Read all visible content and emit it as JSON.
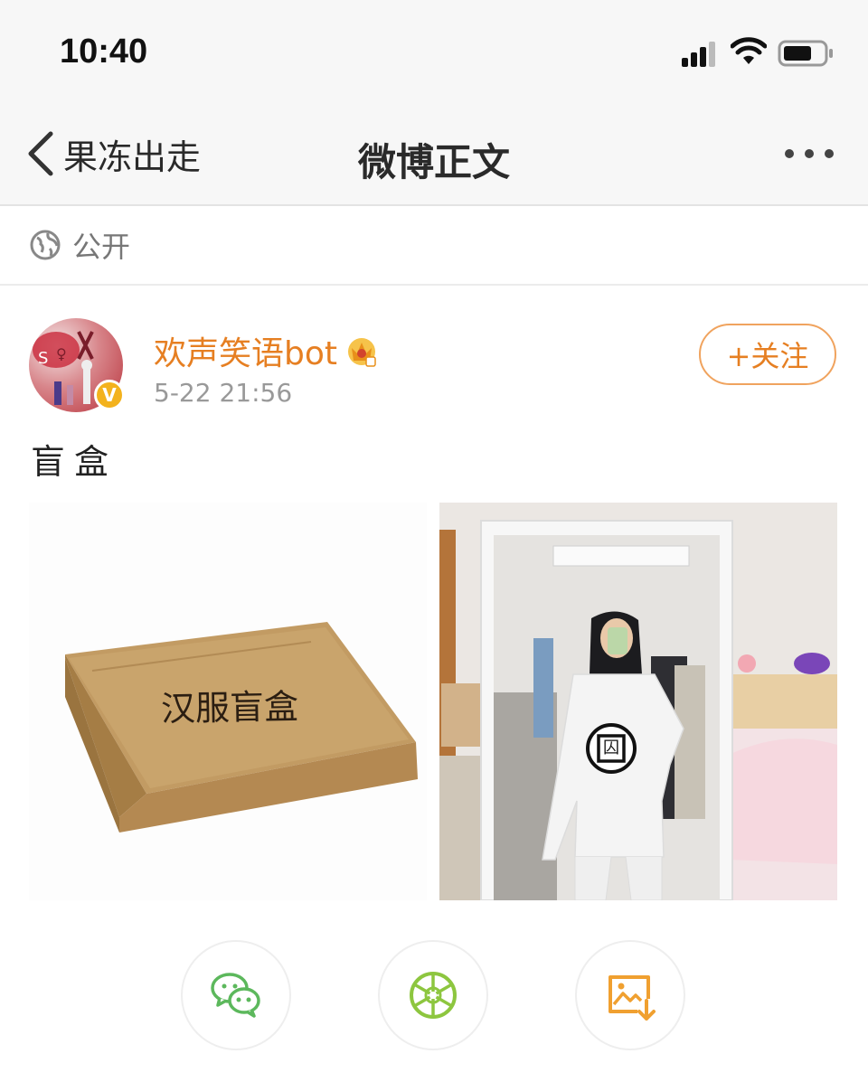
{
  "status_bar": {
    "time": "10:40",
    "signal_icon": "cellular-signal-icon",
    "wifi_icon": "wifi-icon",
    "battery_icon": "battery-icon"
  },
  "nav": {
    "back_label": "果冻出走",
    "title": "微博正文",
    "more_icon": "more-dots-icon"
  },
  "visibility": {
    "label": "公开",
    "icon": "globe-icon"
  },
  "post": {
    "author": "欢声笑语bot",
    "author_badge_icon": "crown-icon",
    "verified_icon": "verified-v-icon",
    "verified_glyph": "V",
    "time": "5-22 21:56",
    "follow_label": "+关注",
    "text": "盲盒",
    "images": [
      {
        "name": "box-image",
        "caption": "汉服盲盒"
      },
      {
        "name": "mirror-selfie-image",
        "shirt_glyph": "囚"
      }
    ]
  },
  "share": {
    "buttons": [
      {
        "icon": "wechat-icon"
      },
      {
        "icon": "moments-shutter-icon"
      },
      {
        "icon": "save-image-icon"
      }
    ]
  },
  "colors": {
    "accent": "#e67f22",
    "follow_border": "#f0a35e",
    "wechat_green": "#5cb85c",
    "moments_green": "#8dc63f",
    "save_orange": "#f0a030"
  }
}
